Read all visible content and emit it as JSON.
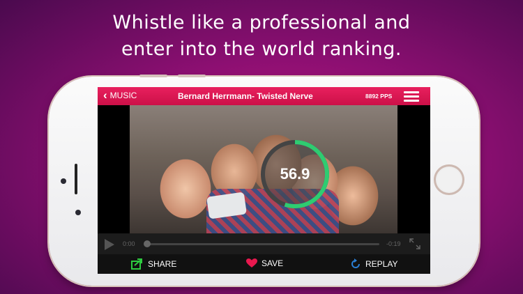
{
  "headline": {
    "line1": "Whistle like a professional and",
    "line2": "enter into the world ranking."
  },
  "app": {
    "topbar": {
      "back_label": "MUSIC",
      "back_icon": "chevron-left-icon",
      "song_title": "Bernard Herrmann- Twisted Nerve",
      "pps": "8892 PPS",
      "menu_icon": "hamburger-menu-icon"
    },
    "score": {
      "value": "56.9",
      "progress_fraction": 0.55,
      "ring_color": "#2ecc71",
      "track_color": "#444444"
    },
    "player": {
      "current_time": "0:00",
      "remaining_time": "-0:19",
      "progress_fraction": 0.0
    },
    "actions": {
      "share_label": "SHARE",
      "save_label": "SAVE",
      "replay_label": "REPLAY"
    }
  },
  "colors": {
    "accent": "#e0185a",
    "share_icon": "#2ecc40",
    "save_icon": "#e8184e",
    "replay_icon": "#2a7fd6"
  }
}
